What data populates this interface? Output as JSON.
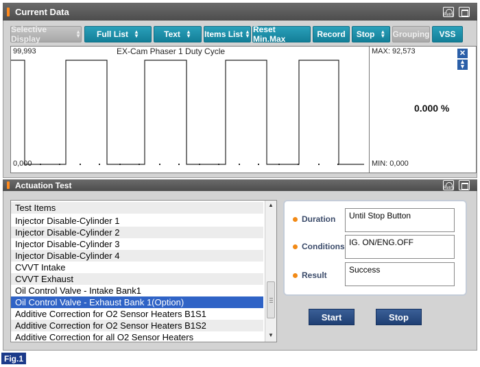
{
  "current_data": {
    "title": "Current Data",
    "retry_label": "Retry",
    "toolbar": [
      {
        "label": "Selective Display",
        "dropdown": true,
        "disabled": true
      },
      {
        "label": "Full List",
        "dropdown": true,
        "disabled": false
      },
      {
        "label": "Text",
        "dropdown": true,
        "disabled": false
      },
      {
        "label": "Items List",
        "dropdown": true,
        "disabled": false
      },
      {
        "label": "Reset Min.Max",
        "dropdown": false,
        "disabled": false
      },
      {
        "label": "Record",
        "dropdown": false,
        "disabled": false
      },
      {
        "label": "Stop",
        "dropdown": true,
        "disabled": false
      },
      {
        "label": "Grouping",
        "dropdown": false,
        "disabled": true
      },
      {
        "label": "VSS",
        "dropdown": false,
        "disabled": false
      }
    ],
    "graph": {
      "title": "EX-Cam Phaser 1 Duty Cycle",
      "y_max_label": "99,993",
      "y_min_label": "0,000",
      "max_label": "MAX: 92,573",
      "min_label": "MIN: 0,000",
      "current_value": "0.000 %"
    }
  },
  "actuation_test": {
    "title": "Actuation Test",
    "retry_label": "Retry",
    "list_header": "Test Items",
    "items": [
      "Injector Disable-Cylinder 1",
      "Injector Disable-Cylinder 2",
      "Injector Disable-Cylinder 3",
      "Injector Disable-Cylinder 4",
      "CVVT Intake",
      "CVVT Exhaust",
      "Oil Control Valve - Intake Bank1",
      "Oil Control Valve - Exhaust Bank 1(Option)",
      "Additive Correction for O2 Sensor Heaters B1S1",
      "Additive Correction for O2 Sensor Heaters B1S2",
      "Additive Correction for all O2 Sensor Heaters"
    ],
    "selected_index": 7,
    "duration_label": "Duration",
    "duration_value": "Until Stop Button",
    "conditions_label": "Conditions",
    "conditions_value": "IG. ON/ENG.OFF",
    "result_label": "Result",
    "result_value": "Success",
    "start_label": "Start",
    "stop_label": "Stop"
  },
  "figure_label": "Fig.1",
  "colors": {
    "accent": "#1a87a3",
    "selection": "#2f63c6",
    "bullet": "#f28a16"
  }
}
